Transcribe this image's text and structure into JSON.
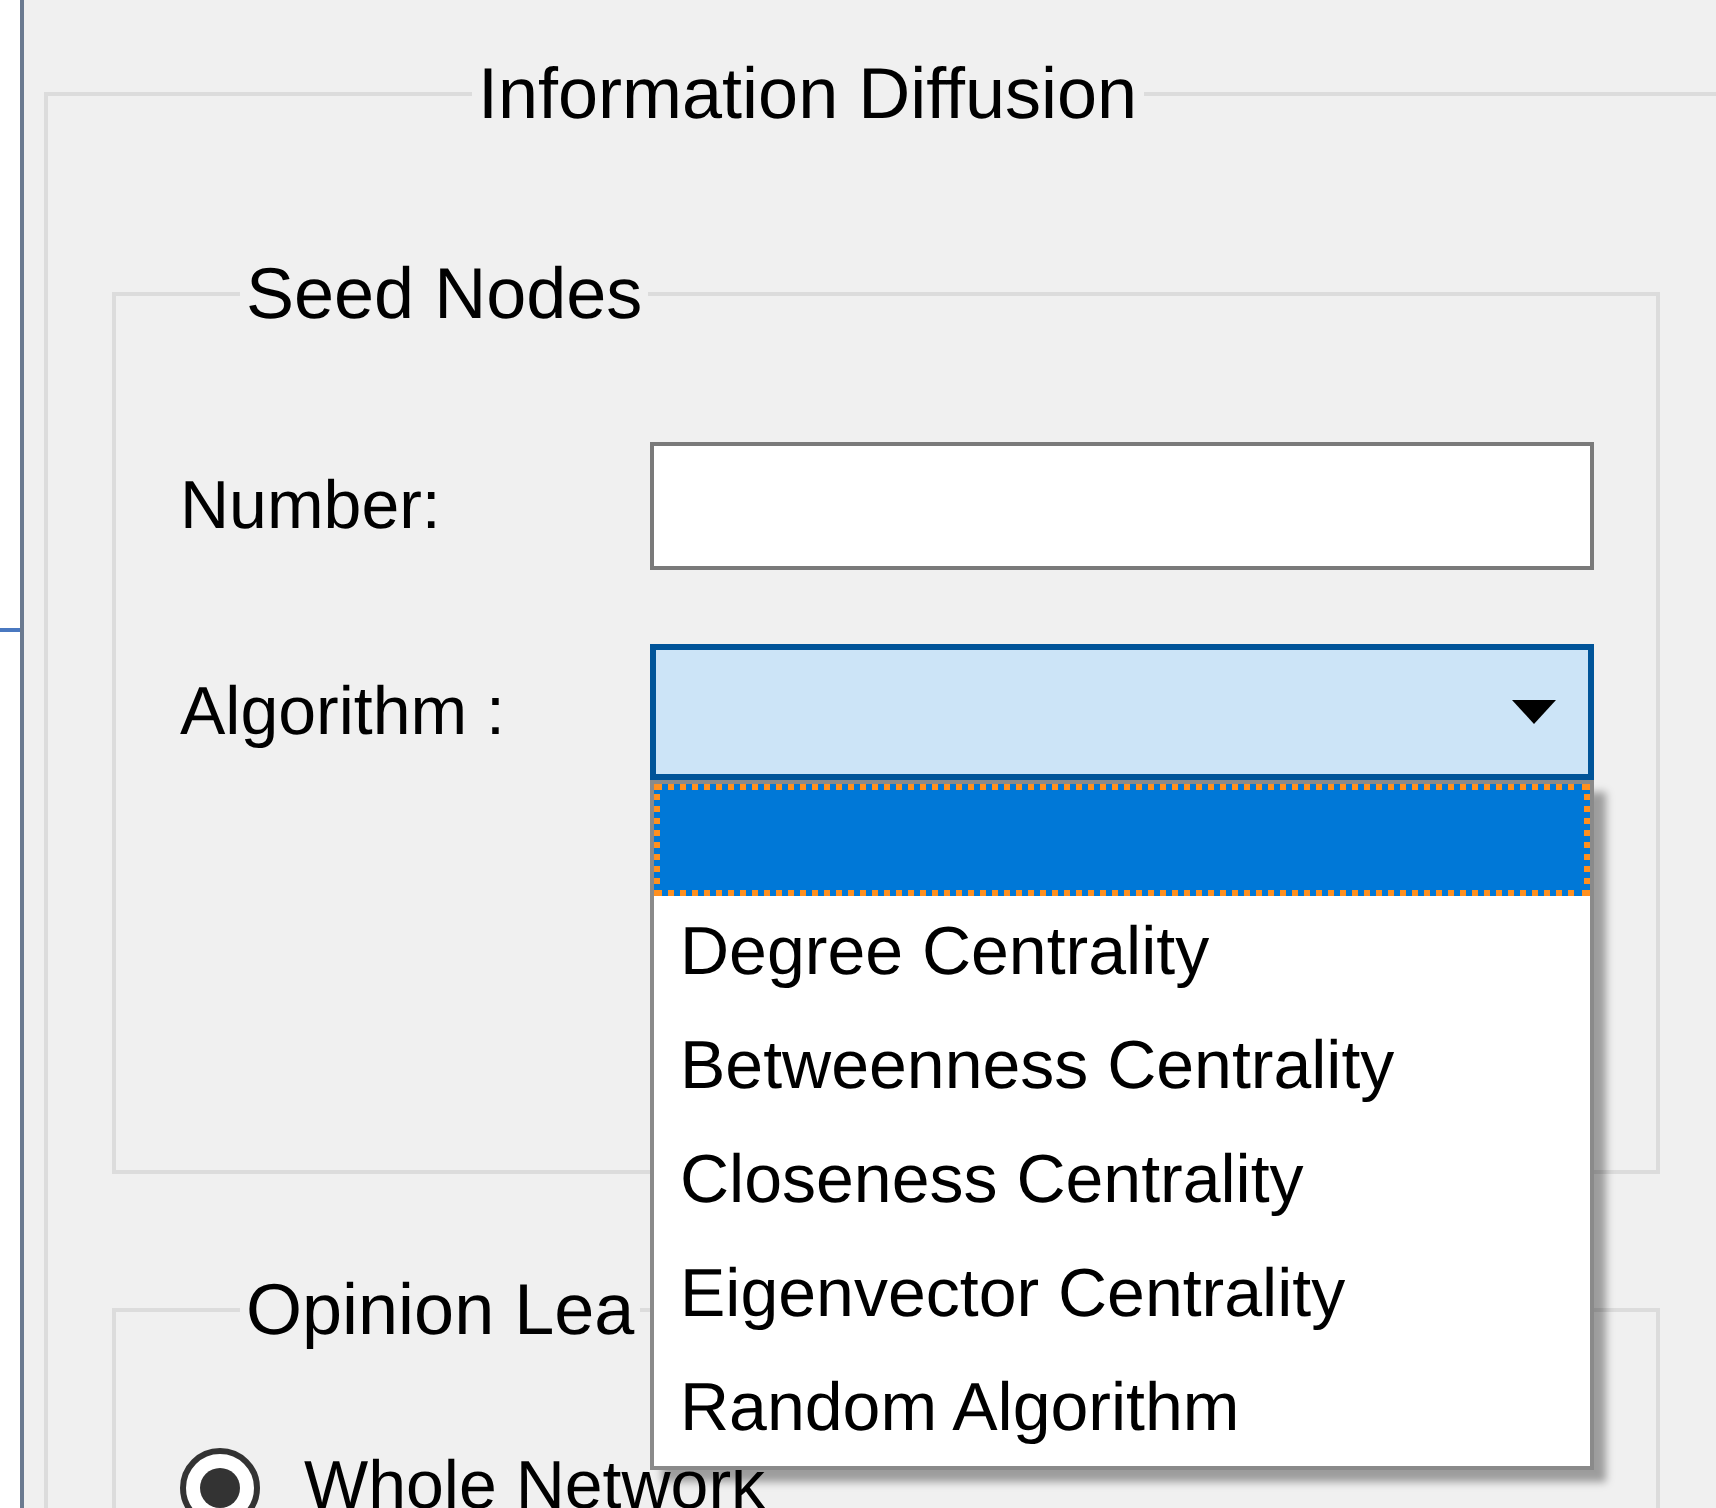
{
  "group": {
    "title": "Information Diffusion"
  },
  "seed_nodes": {
    "title": "Seed Nodes",
    "number": {
      "label": "Number:"
    },
    "algorithm": {
      "label": "Algorithm :",
      "expanded": true,
      "options": [
        {
          "selected": true
        },
        {
          "label": "Degree Centrality",
          "selected": false
        },
        {
          "label": "Betweenness Centrality",
          "selected": false
        },
        {
          "label": "Closeness Centrality",
          "selected": false
        },
        {
          "label": "Eigenvector Centrality",
          "selected": false
        },
        {
          "label": "Random Algorithm",
          "selected": false
        }
      ]
    }
  },
  "opinion_leaders": {
    "title": "Opinion Lea",
    "radios": [
      {
        "label": "Whole Network",
        "selected": true
      }
    ]
  }
}
